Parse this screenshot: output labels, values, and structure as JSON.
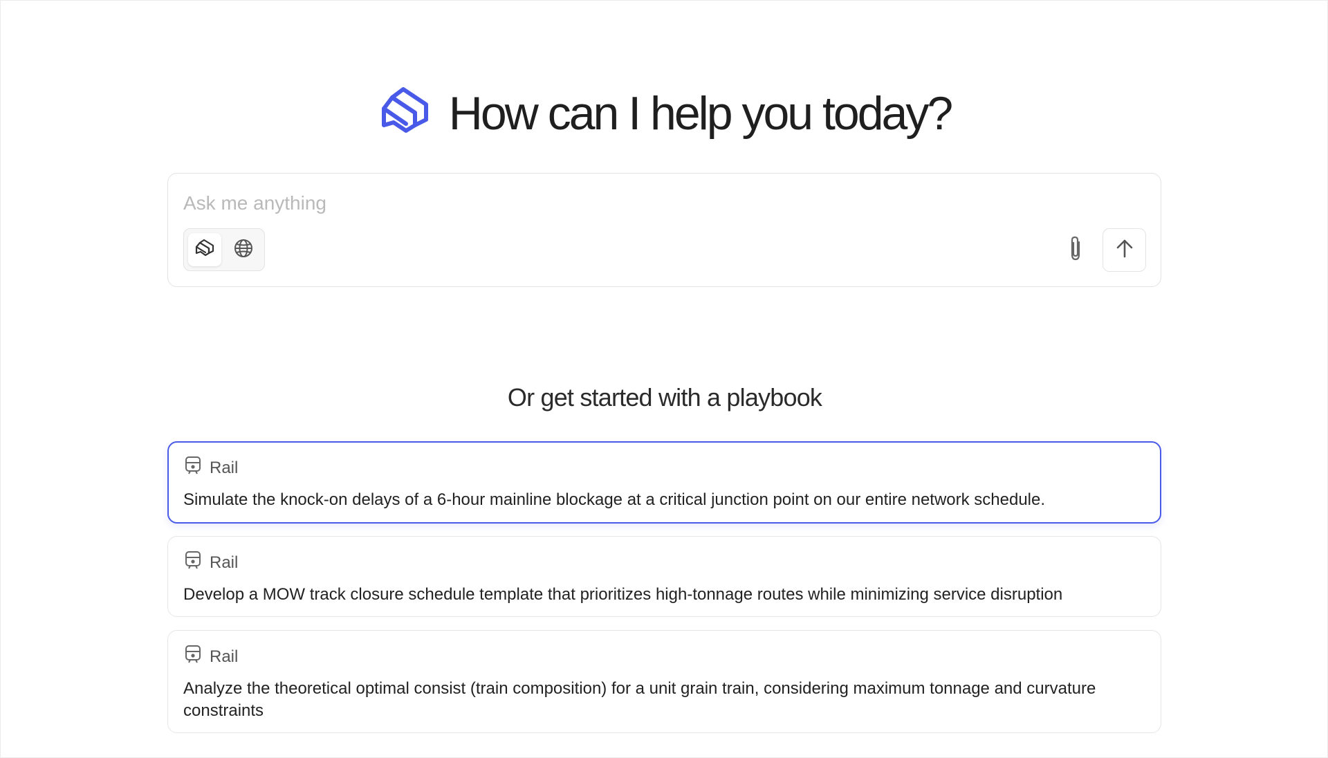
{
  "hero": {
    "logo_icon": "stacked-chat-logo-icon",
    "title": "How can I help you today?",
    "brand_color": "#4a5ae8"
  },
  "composer": {
    "placeholder": "Ask me anything",
    "value": "",
    "modes": [
      {
        "name": "assistant-mode",
        "icon": "stacked-chat-icon",
        "active": true
      },
      {
        "name": "web-search-mode",
        "icon": "globe-icon",
        "active": false
      }
    ],
    "attach_icon": "paperclip-icon",
    "send_icon": "arrow-up-icon"
  },
  "playbooks": {
    "heading": "Or get started with a playbook",
    "items": [
      {
        "category": "Rail",
        "category_icon": "train-icon",
        "text": "Simulate the knock-on delays of a 6-hour mainline blockage at a critical junction point on our entire network schedule.",
        "selected": true
      },
      {
        "category": "Rail",
        "category_icon": "train-icon",
        "text": "Develop a MOW track closure schedule template that prioritizes high-tonnage routes while minimizing service disruption",
        "selected": false
      },
      {
        "category": "Rail",
        "category_icon": "train-icon",
        "text": "Analyze the theoretical optimal consist (train composition) for a unit grain train, considering maximum tonnage and curvature constraints",
        "selected": false
      }
    ]
  }
}
